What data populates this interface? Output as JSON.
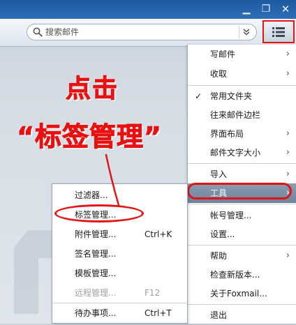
{
  "window": {
    "buttons": {
      "minimize": "▁",
      "restore": "❐",
      "close": "✕"
    }
  },
  "search": {
    "placeholder": "搜索邮件",
    "icon": "search-icon",
    "dropdown_icon": "double-chevron-down-icon"
  },
  "menu_button": {
    "icon": "list-menu-icon",
    "highlight_color": "#e41414"
  },
  "annotation": {
    "line1": "点击",
    "line2": "“标签管理”",
    "color": "#e81010"
  },
  "main_menu": {
    "items": [
      {
        "label": "写邮件",
        "arrow": "›"
      },
      {
        "label": "收取",
        "arrow": "›"
      },
      {
        "label": "常用文件夹",
        "check": "✓"
      },
      {
        "label": "往来邮件边栏"
      },
      {
        "label": "界面布局",
        "arrow": "›"
      },
      {
        "label": "邮件文字大小",
        "arrow": "›"
      },
      {
        "label": "导入",
        "arrow": "›"
      },
      {
        "label": "工具",
        "arrow": "›"
      },
      {
        "label": "帐号管理..."
      },
      {
        "label": "设置..."
      },
      {
        "label": "帮助",
        "arrow": "›"
      },
      {
        "label": "检查新版本..."
      },
      {
        "label": "关于Foxmail..."
      },
      {
        "label": "退出"
      }
    ]
  },
  "tools_submenu": {
    "items": [
      {
        "label": "过滤器...",
        "shortcut": ""
      },
      {
        "label": "标签管理...",
        "shortcut": ""
      },
      {
        "label": "附件管理...",
        "shortcut": "Ctrl+K"
      },
      {
        "label": "签名管理...",
        "shortcut": ""
      },
      {
        "label": "模板管理...",
        "shortcut": ""
      },
      {
        "label": "远程管理...",
        "shortcut": "F12"
      },
      {
        "label": "待办事项...",
        "shortcut": "Ctrl+T"
      }
    ]
  },
  "colors": {
    "titlebar": "#1d5aa0",
    "hover_item": "#7a8ea6",
    "annotation_red": "#e41414"
  }
}
